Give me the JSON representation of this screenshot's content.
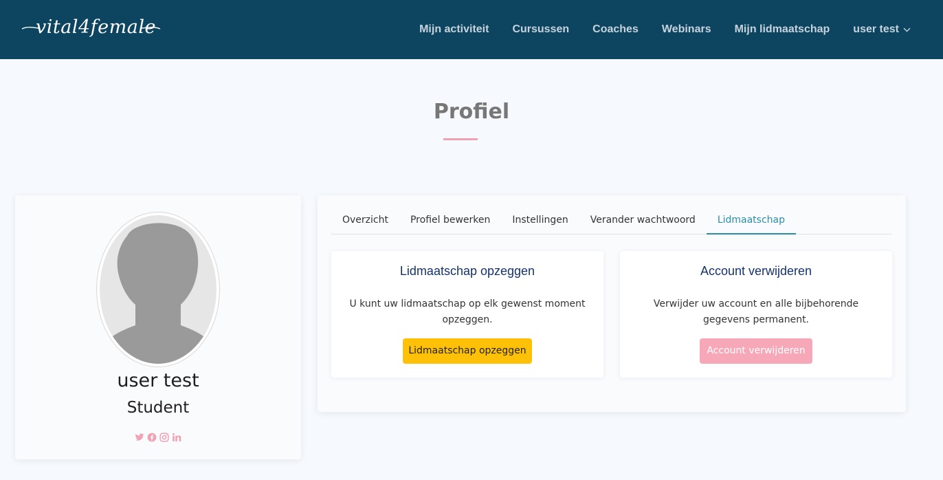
{
  "brand": {
    "logo_text": "vital4female"
  },
  "nav": {
    "items": [
      "Mijn activiteit",
      "Cursussen",
      "Coaches",
      "Webinars",
      "Mijn lidmaatschap"
    ],
    "user_menu": "user test"
  },
  "page": {
    "title": "Profiel"
  },
  "profile": {
    "name": "user test",
    "role": "Student",
    "social_icons": [
      "twitter-icon",
      "facebook-icon",
      "instagram-icon",
      "linkedin-icon"
    ]
  },
  "tabs": {
    "items": [
      "Overzicht",
      "Profiel bewerken",
      "Instellingen",
      "Verander wachtwoord",
      "Lidmaatschap"
    ],
    "active": "Lidmaatschap"
  },
  "cancel_membership": {
    "title": "Lidmaatschap opzeggen",
    "text": "U kunt uw lidmaatschap op elk gewenst moment opzeggen.",
    "button": "Lidmaatschap opzeggen"
  },
  "delete_account": {
    "title": "Account verwijderen",
    "text": "Verwijder uw account en alle bijbehorende gegevens permanent.",
    "button": "Account verwijderen"
  },
  "colors": {
    "navbar": "#0d4560",
    "accent_pink": "#f0a2b4",
    "tab_active": "#2a8da8",
    "warning": "#ffc107",
    "danger_light": "#f7a8b8"
  }
}
